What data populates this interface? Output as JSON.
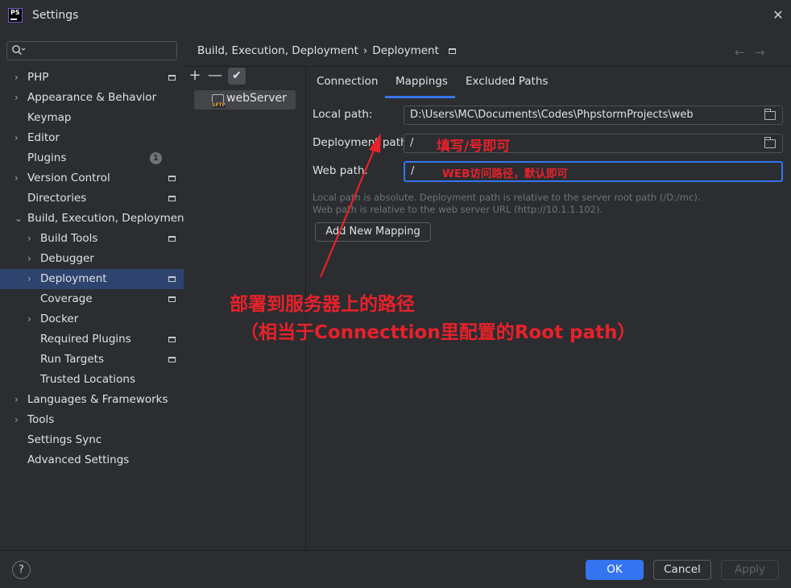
{
  "window": {
    "title": "Settings",
    "logo": "PS",
    "close": "✕"
  },
  "sidebar": {
    "items": [
      {
        "label": "PHP",
        "chevron": "›",
        "indent": 0,
        "pin": true
      },
      {
        "label": "Appearance & Behavior",
        "chevron": "›",
        "indent": 0
      },
      {
        "label": "Keymap",
        "indent": 0
      },
      {
        "label": "Editor",
        "chevron": "›",
        "indent": 0
      },
      {
        "label": "Plugins",
        "indent": 0,
        "badge": "1"
      },
      {
        "label": "Version Control",
        "chevron": "›",
        "indent": 0,
        "pin": true
      },
      {
        "label": "Directories",
        "indent": 0,
        "pin": true
      },
      {
        "label": "Build, Execution, Deployment",
        "chevron": "⌄",
        "indent": 0
      },
      {
        "label": "Build Tools",
        "chevron": "›",
        "indent": 1,
        "pin": true
      },
      {
        "label": "Debugger",
        "chevron": "›",
        "indent": 1
      },
      {
        "label": "Deployment",
        "chevron": "›",
        "indent": 1,
        "pin": true,
        "selected": true
      },
      {
        "label": "Coverage",
        "indent": 1,
        "pin": true
      },
      {
        "label": "Docker",
        "chevron": "›",
        "indent": 1
      },
      {
        "label": "Required Plugins",
        "indent": 1,
        "pin": true
      },
      {
        "label": "Run Targets",
        "indent": 1,
        "pin": true
      },
      {
        "label": "Trusted Locations",
        "indent": 1
      },
      {
        "label": "Languages & Frameworks",
        "chevron": "›",
        "indent": 0
      },
      {
        "label": "Tools",
        "chevron": "›",
        "indent": 0
      },
      {
        "label": "Settings Sync",
        "indent": 0
      },
      {
        "label": "Advanced Settings",
        "indent": 0
      }
    ]
  },
  "breadcrumb": {
    "parent": "Build, Execution, Deployment",
    "separator": "›",
    "current": "Deployment"
  },
  "nav": {
    "back": "←",
    "forward": "→"
  },
  "toolbar": {
    "add": "+",
    "remove": "—",
    "default": "✔"
  },
  "servers": [
    {
      "name": "webServer"
    }
  ],
  "tabs": [
    {
      "label": "Connection"
    },
    {
      "label": "Mappings",
      "active": true
    },
    {
      "label": "Excluded Paths"
    }
  ],
  "mapping": {
    "local_path_label": "Local path:",
    "local_path_value": "D:\\Users\\MC\\Documents\\Codes\\PhpstormProjects\\web",
    "deployment_path_label": "Deployment path:",
    "deployment_path_value": "/",
    "web_path_label": "Web path:",
    "web_path_value": "/",
    "hint_1": "Local path is absolute. Deployment path is relative to the server root path (/D:/mc).",
    "hint_2": "Web path is relative to the web server URL (http://10.1.1.102).",
    "add_mapping_label": "Add New Mapping"
  },
  "annotations": {
    "deployment_note": "填写/号即可",
    "web_note": "WEB访问路径，默认即可",
    "big_line_1": "部署到服务器上的路径",
    "big_line_2": "（相当于Connecttion里配置的Root path）",
    "color": "#e8212a"
  },
  "footer": {
    "help": "?",
    "ok": "OK",
    "cancel": "Cancel",
    "apply": "Apply"
  },
  "colors": {
    "background": "#2b2d30",
    "accent": "#3574f0",
    "selection": "#2e436e"
  }
}
